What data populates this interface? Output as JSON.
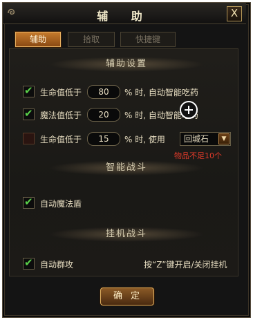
{
  "window": {
    "title": "辅 助",
    "close_label": "X"
  },
  "tabs": [
    {
      "label": "辅助",
      "active": true
    },
    {
      "label": "拾取",
      "active": false
    },
    {
      "label": "快捷键",
      "active": false
    }
  ],
  "sections": {
    "assist": "辅助设置",
    "combat": "智能战斗",
    "idle": "挂机战斗"
  },
  "rows": {
    "hp": {
      "checked": true,
      "label": "生命值低于",
      "value": "80",
      "suffix": "% 时, 自动智能吃药"
    },
    "mp": {
      "checked": true,
      "label": "魔法值低于",
      "value": "20",
      "suffix": "% 时, 自动智能吃药"
    },
    "hp2": {
      "checked": false,
      "label": "生命值低于",
      "value": "15",
      "suffix": "% 时, 使用",
      "select": "回城石",
      "warning": "物品不足10个"
    }
  },
  "auto_shield": {
    "checked": true,
    "label": "自动魔法盾"
  },
  "auto_group": {
    "checked": true,
    "label": "自动群攻",
    "hint": "按“Z”键开启/关闭挂机"
  },
  "confirm_label": "确定",
  "colors": {
    "check": "#5ad24a",
    "accent_tab": "#c47a2c",
    "warning": "#e03a2a"
  }
}
